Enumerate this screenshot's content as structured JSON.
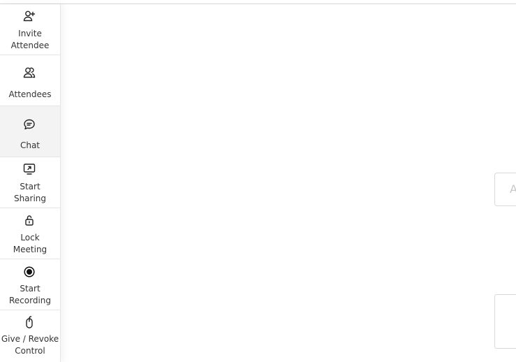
{
  "sidebar": {
    "items": [
      {
        "label_line1": "Invite",
        "label_line2": "Attendee",
        "icon": "invite-attendee-icon"
      },
      {
        "label_line1": "Attendees",
        "icon": "attendees-icon"
      },
      {
        "label_line1": "Chat",
        "icon": "chat-icon",
        "active": true
      },
      {
        "label_line1": "Start",
        "label_line2": "Sharing",
        "icon": "screen-share-icon"
      },
      {
        "label_line1": "Lock",
        "label_line2": "Meeting",
        "icon": "lock-icon"
      },
      {
        "label_line1": "Start",
        "label_line2": "Recording",
        "icon": "record-icon"
      },
      {
        "label_line1": "Give / Revoke",
        "label_line2": "Control",
        "icon": "mouse-icon"
      }
    ]
  },
  "main": {
    "partial_field_text": "A"
  },
  "colors": {
    "text": "#333333",
    "active_bg": "#f3f3f3",
    "divider": "#e5e5e5"
  }
}
